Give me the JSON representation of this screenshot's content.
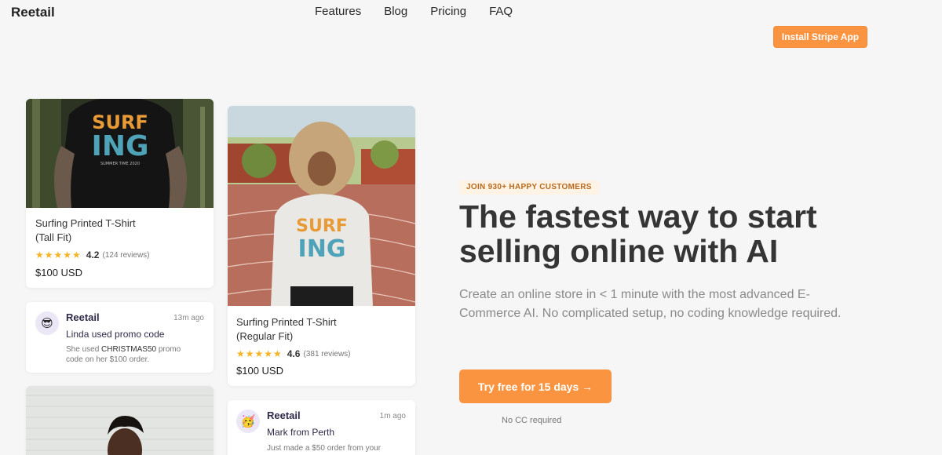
{
  "header": {
    "logo": "Reetail",
    "nav": [
      "Features",
      "Blog",
      "Pricing",
      "FAQ"
    ],
    "install_button": "Install Stripe App"
  },
  "products": [
    {
      "title_line1": "Surfing Printed T-Shirt",
      "title_line2": "(Tall Fit)",
      "rating": "4.2",
      "reviews": "(124 reviews)",
      "price": "$100 USD",
      "print_text_1": "SURF",
      "print_text_2": "ING"
    },
    {
      "title_line1": "Surfing Printed T-Shirt",
      "title_line2": "(Regular Fit)",
      "rating": "4.6",
      "reviews": "(381 reviews)",
      "price": "$100 USD",
      "print_text_1": "SURF",
      "print_text_2": "ING"
    }
  ],
  "notifications": [
    {
      "brand": "Reetail",
      "time": "13m ago",
      "title": "Linda used promo code",
      "body_prefix": "She used ",
      "body_code": "CHRISTMAS50",
      "body_suffix": " promo code on her $100 order.",
      "emoji": "😎"
    },
    {
      "brand": "Reetail",
      "time": "1m ago",
      "title": "Mark from Perth",
      "body": "Just made a $50 order from your",
      "emoji": "🥳"
    }
  ],
  "hero": {
    "badge": "JOIN 930+ HAPPY CUSTOMERS",
    "headline_line1": "The fastest way to start",
    "headline_line2": "selling online with AI",
    "subtext": "Create an online store in < 1 minute with the most advanced E-Commerce AI. No complicated setup, no coding knowledge required.",
    "cta": "Try free for 15 days →",
    "note": "No CC required"
  },
  "colors": {
    "accent": "#fb9441",
    "background": "#f6f6f6",
    "star": "#f5b321"
  }
}
